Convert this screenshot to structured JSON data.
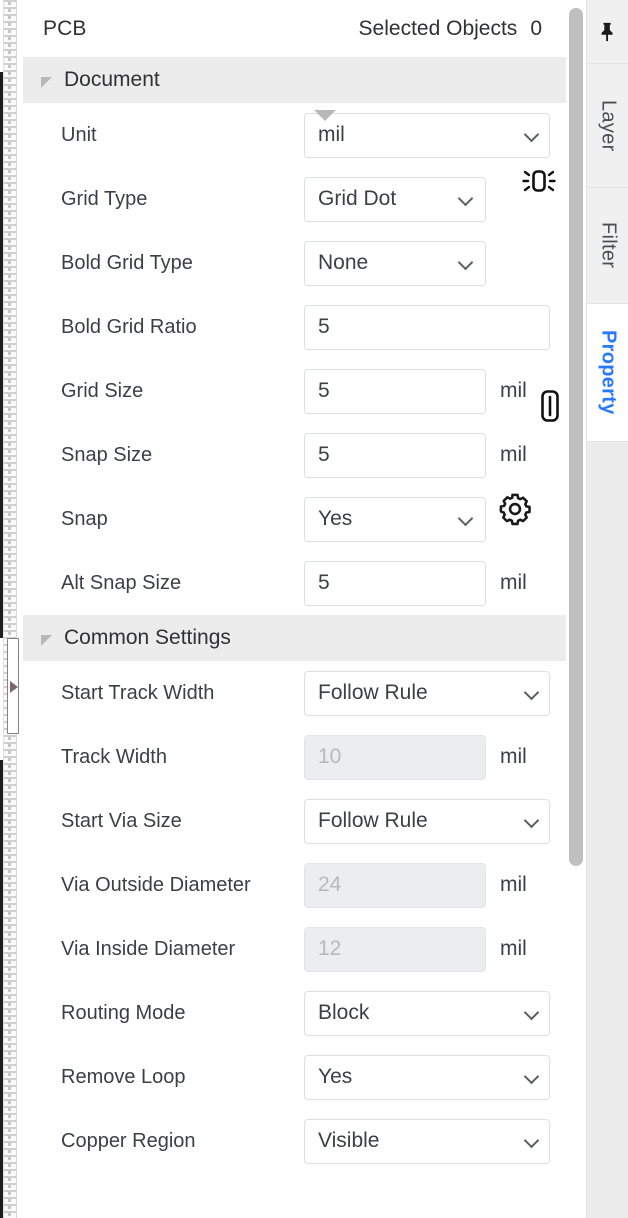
{
  "header": {
    "title": "PCB",
    "selected_label": "Selected Objects",
    "selected_count": "0",
    "pin_icon": "pin-icon"
  },
  "sections": [
    {
      "id": "document",
      "label": "Document",
      "collapse_icon": "caret-collapse-icon",
      "rows": [
        {
          "label": "Unit",
          "type": "select",
          "value": "mil",
          "width": "wide",
          "unit": "",
          "icon": ""
        },
        {
          "label": "Grid Type",
          "type": "select",
          "value": "Grid Dot",
          "width": "mid",
          "unit": "",
          "icon": "grid-highlight-icon"
        },
        {
          "label": "Bold Grid Type",
          "type": "select",
          "value": "None",
          "width": "mid",
          "unit": "",
          "icon": ""
        },
        {
          "label": "Bold Grid Ratio",
          "type": "input",
          "value": "5",
          "width": "wide",
          "unit": "",
          "icon": ""
        },
        {
          "label": "Grid Size",
          "type": "input",
          "value": "5",
          "width": "mid",
          "unit": "mil",
          "icon": ""
        },
        {
          "label": "Snap Size",
          "type": "input",
          "value": "5",
          "width": "mid",
          "unit": "mil",
          "icon": "snap-size-icon"
        },
        {
          "label": "Snap",
          "type": "select",
          "value": "Yes",
          "width": "mid",
          "unit": "",
          "icon": "gear-icon"
        },
        {
          "label": "Alt Snap Size",
          "type": "input",
          "value": "5",
          "width": "mid",
          "unit": "mil",
          "icon": ""
        }
      ]
    },
    {
      "id": "common-settings",
      "label": "Common Settings",
      "collapse_icon": "caret-collapse-icon",
      "rows": [
        {
          "label": "Start Track Width",
          "type": "select",
          "value": "Follow Rule",
          "width": "wide",
          "unit": "",
          "icon": "",
          "disabled": false
        },
        {
          "label": "Track Width",
          "type": "input",
          "value": "10",
          "width": "mid",
          "unit": "mil",
          "icon": "",
          "disabled": true
        },
        {
          "label": "Start Via Size",
          "type": "select",
          "value": "Follow Rule",
          "width": "wide",
          "unit": "",
          "icon": "",
          "disabled": false
        },
        {
          "label": "Via Outside Diameter",
          "type": "input",
          "value": "24",
          "width": "mid",
          "unit": "mil",
          "icon": "",
          "disabled": true
        },
        {
          "label": "Via Inside Diameter",
          "type": "input",
          "value": "12",
          "width": "mid",
          "unit": "mil",
          "icon": "",
          "disabled": true
        },
        {
          "label": "Routing Mode",
          "type": "select",
          "value": "Block",
          "width": "wide",
          "unit": "",
          "icon": "",
          "disabled": false
        },
        {
          "label": "Remove Loop",
          "type": "select",
          "value": "Yes",
          "width": "wide",
          "unit": "",
          "icon": "",
          "disabled": false
        },
        {
          "label": "Copper Region",
          "type": "select",
          "value": "Visible",
          "width": "wide",
          "unit": "",
          "icon": "",
          "disabled": false
        }
      ]
    }
  ],
  "tabs": [
    {
      "id": "layer",
      "label": "Layer",
      "active": false
    },
    {
      "id": "filter",
      "label": "Filter",
      "active": false
    },
    {
      "id": "property",
      "label": "Property",
      "active": true
    }
  ],
  "colors": {
    "accent": "#2878ff",
    "section_bg": "#ececec",
    "panel_bg": "#ffffff",
    "text": "#3b3f46",
    "field_border": "#dcdfe6",
    "disabled_bg": "#ebedef",
    "disabled_text": "#b6babf",
    "scrollbar": "#c0c0c0"
  }
}
